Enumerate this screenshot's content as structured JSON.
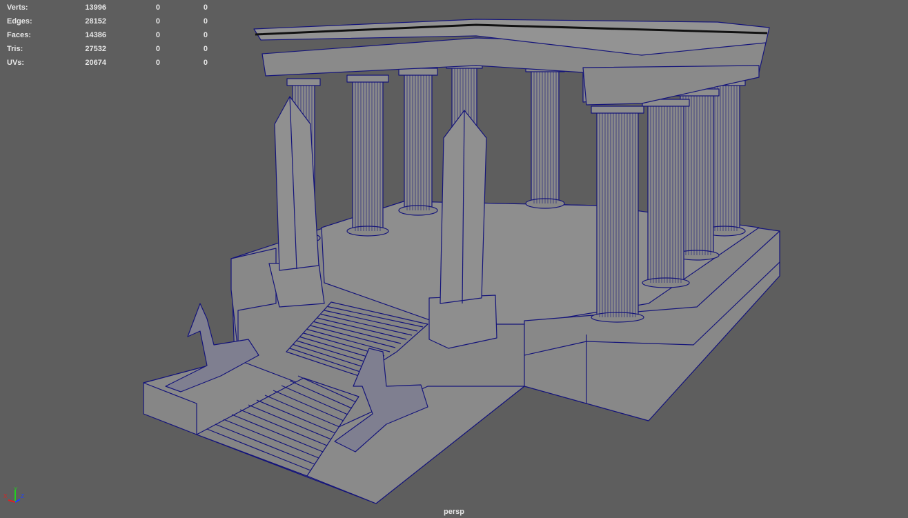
{
  "hud": {
    "stats": [
      {
        "label": "Verts:",
        "values": [
          "13996",
          "0",
          "0"
        ]
      },
      {
        "label": "Edges:",
        "values": [
          "28152",
          "0",
          "0"
        ]
      },
      {
        "label": "Faces:",
        "values": [
          "14386",
          "0",
          "0"
        ]
      },
      {
        "label": "Tris:",
        "values": [
          "27532",
          "0",
          "0"
        ]
      },
      {
        "label": "UVs:",
        "values": [
          "20674",
          "0",
          "0"
        ]
      }
    ],
    "camera_name": "persp",
    "axis": {
      "x": "X",
      "y": "Y",
      "z": "Z"
    }
  },
  "colors": {
    "background": "#5e5e5e",
    "mesh": "#8c8c8c",
    "wire": "#14147a",
    "axis_x": "#e02020",
    "axis_y": "#20d020",
    "axis_z": "#2040ff"
  }
}
